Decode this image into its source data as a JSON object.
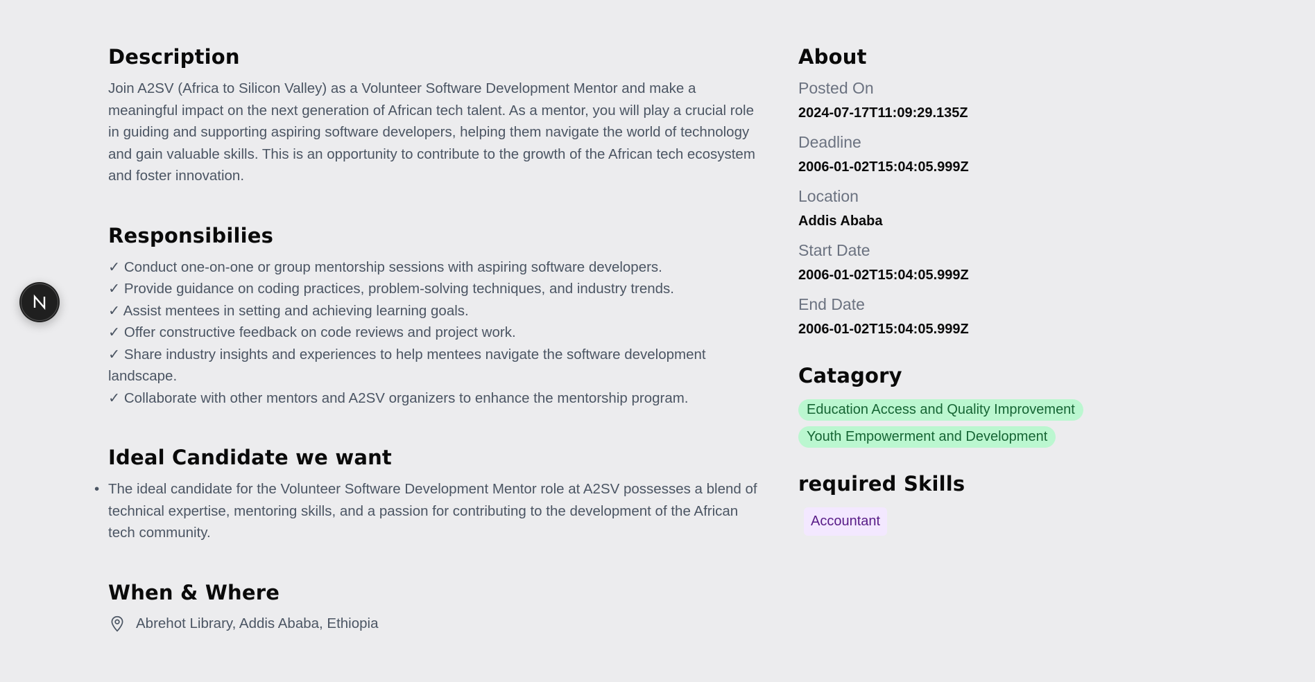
{
  "description": {
    "heading": "Description",
    "text": "Join A2SV (Africa to Silicon Valley) as a Volunteer Software Development Mentor and make a meaningful impact on the next generation of African tech talent. As a mentor, you will play a crucial role in guiding and supporting aspiring software developers, helping them navigate the world of technology and gain valuable skills. This is an opportunity to contribute to the growth of the African tech ecosystem and foster innovation."
  },
  "responsibilities": {
    "heading": "Responsibilies",
    "items": [
      "✓ Conduct one-on-one or group mentorship sessions with aspiring software developers.",
      "✓ Provide guidance on coding practices, problem-solving techniques, and industry trends.",
      "✓ Assist mentees in setting and achieving learning goals.",
      "✓ Offer constructive feedback on code reviews and project work.",
      "✓ Share industry insights and experiences to help mentees navigate the software development landscape.",
      "✓ Collaborate with other mentors and A2SV organizers to enhance the mentorship program."
    ]
  },
  "ideal_candidate": {
    "heading": "Ideal Candidate we want",
    "items": [
      "The ideal candidate for the Volunteer Software Development Mentor role at A2SV possesses a blend of technical expertise, mentoring skills, and a passion for contributing to the development of the African tech community."
    ]
  },
  "when_where": {
    "heading": "When & Where",
    "location": "Abrehot Library, Addis Ababa, Ethiopia",
    "icon": "location-pin-icon"
  },
  "about": {
    "heading": "About",
    "fields": [
      {
        "label": "Posted On",
        "value": "2024-07-17T11:09:29.135Z"
      },
      {
        "label": "Deadline",
        "value": "2006-01-02T15:04:05.999Z"
      },
      {
        "label": "Location",
        "value": "Addis Ababa"
      },
      {
        "label": "Start Date",
        "value": "2006-01-02T15:04:05.999Z"
      },
      {
        "label": "End Date",
        "value": "2006-01-02T15:04:05.999Z"
      }
    ]
  },
  "category": {
    "heading": "Catagory",
    "tags": [
      "Education Access and Quality Improvement",
      "Youth Empowerment and Development"
    ],
    "tag_bg": "#bbf7d0",
    "tag_color": "#166534"
  },
  "skills": {
    "heading": "required Skills",
    "tags": [
      "Accountant"
    ],
    "tag_bg": "#f3e8ff",
    "tag_color": "#581c87"
  },
  "badge": {
    "letter": "N",
    "icon": "nextjs-logo-icon"
  }
}
